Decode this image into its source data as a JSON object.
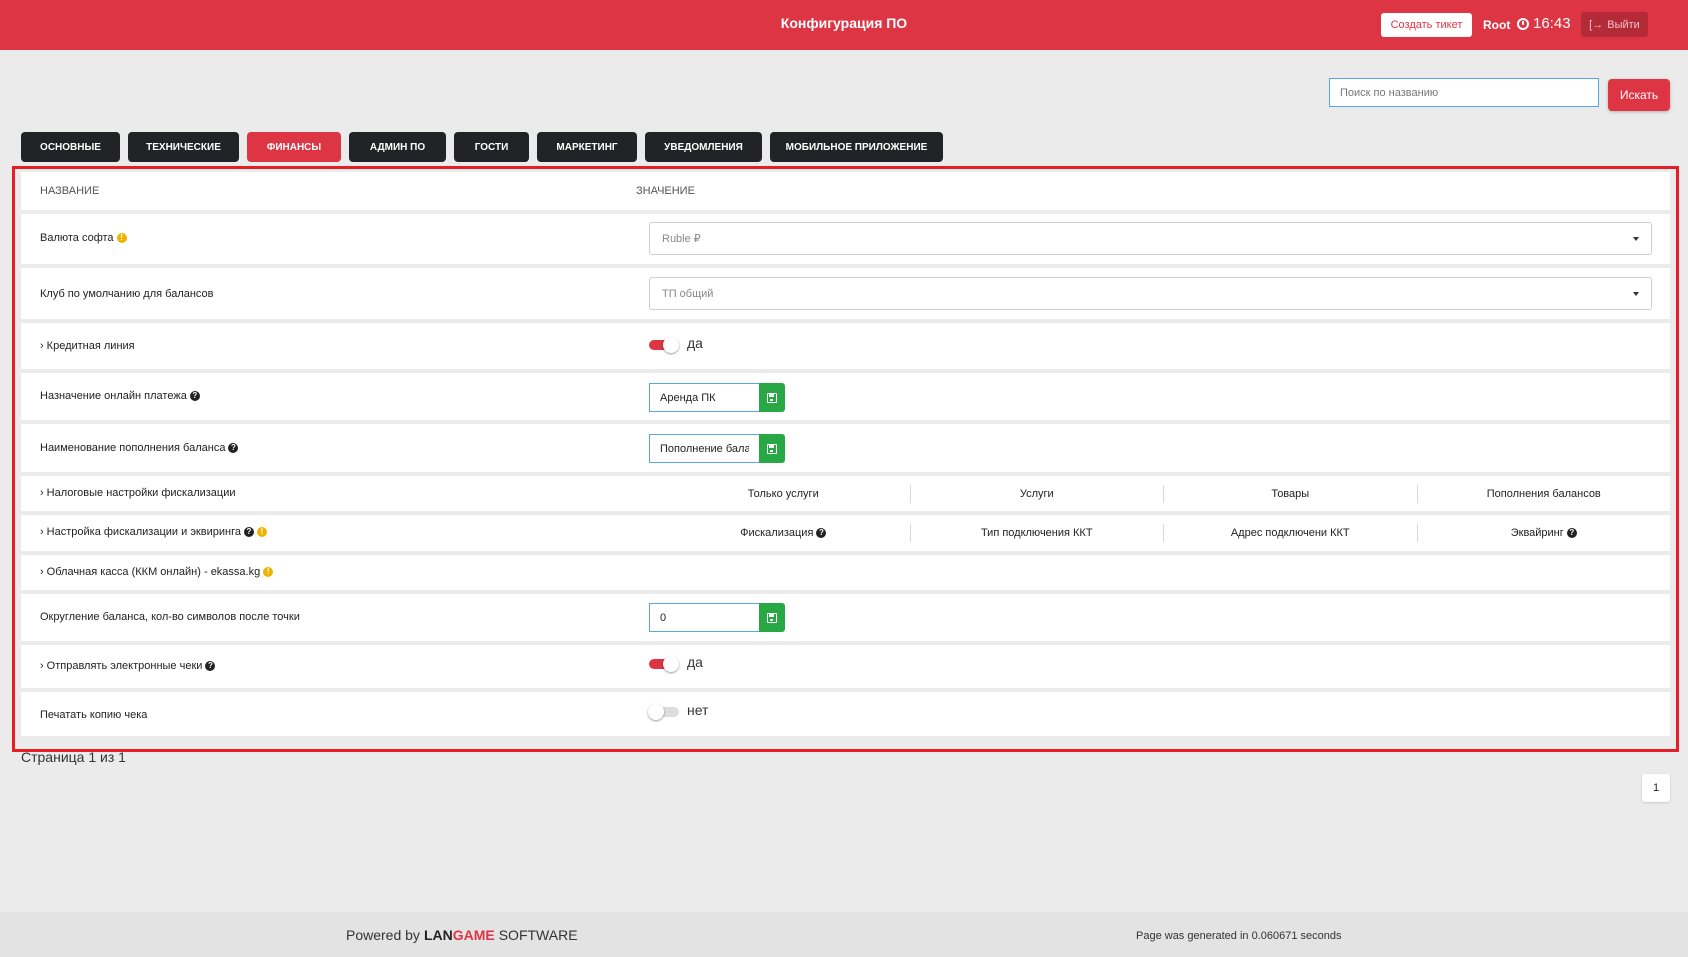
{
  "header": {
    "title": "Конфигурация ПО",
    "create_ticket": "Создать тикет",
    "user": "Root",
    "time": "16:43",
    "logout": "Выйти"
  },
  "search": {
    "placeholder": "Поиск по названию",
    "button": "Искать"
  },
  "tabs": [
    {
      "label": "Основные",
      "active": false
    },
    {
      "label": "Технические",
      "active": false
    },
    {
      "label": "Финансы",
      "active": true
    },
    {
      "label": "Админ ПО",
      "active": false
    },
    {
      "label": "Гости",
      "active": false
    },
    {
      "label": "Маркетинг",
      "active": false
    },
    {
      "label": "Уведомления",
      "active": false
    },
    {
      "label": "Мобильное приложение",
      "active": false
    }
  ],
  "table": {
    "col_name": "Название",
    "col_value": "Значение",
    "rows": {
      "currency": {
        "label": "Валюта софта",
        "value": "Ruble ₽"
      },
      "club": {
        "label": "Клуб по умолчанию для балансов",
        "value": "ТП общий"
      },
      "credit": {
        "label": "Кредитная линия",
        "value": "да"
      },
      "payment_purpose": {
        "label": "Назначение онлайн платежа",
        "value": "Аренда ПК"
      },
      "balance_name": {
        "label": "Наименование пополнения баланса",
        "value": "Пополнение баланса"
      },
      "tax": {
        "label": "Налоговые настройки фискализации",
        "subcols": [
          "Только услуги",
          "Услуги",
          "Товары",
          "Пополнения балансов"
        ]
      },
      "fiscal": {
        "label": "Настройка фискализации и эквиринга",
        "subcols": [
          "Фискализация",
          "Тип подключения ККТ",
          "Адрес подключени ККТ",
          "Эквайринг"
        ]
      },
      "cloud": {
        "label": "Облачная касса (ККМ онлайн) - ekassa.kg"
      },
      "rounding": {
        "label": "Округление баланса, кол-во символов после точки",
        "value": "0"
      },
      "receipts": {
        "label": "Отправлять электронные чеки",
        "value": "да"
      },
      "print_copy": {
        "label": "Печатать копию чека",
        "value": "нет"
      }
    }
  },
  "pagination": {
    "info": "Страница 1 из 1",
    "page": "1"
  },
  "footer": {
    "powered_by": "Powered by",
    "brand_lan": "LAN",
    "brand_game": "GAME",
    "brand_software": "SOFTWARE",
    "generated": "Page was generated in 0.060671 seconds"
  },
  "colors": {
    "accent": "#de3545",
    "success": "#28a745",
    "dark_tab": "#222326",
    "frame": "#e61f26"
  }
}
